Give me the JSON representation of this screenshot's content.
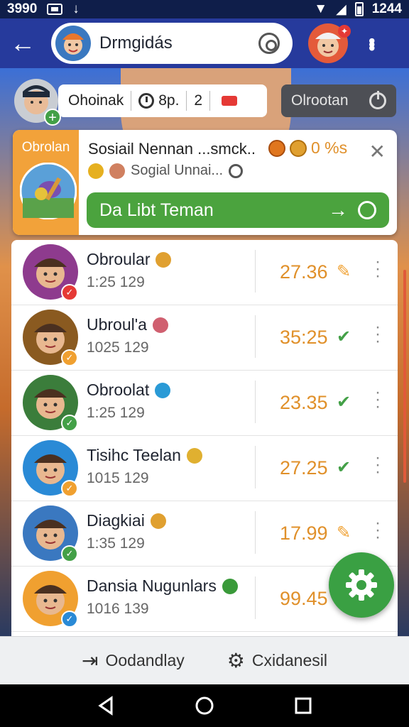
{
  "status_bar": {
    "left_text": "3990",
    "time": "1244"
  },
  "app_bar": {
    "title": "Drmgidás"
  },
  "status_row": {
    "name": "Ohoinak",
    "timer": "8p.",
    "count": "2",
    "action_label": "Olrootan"
  },
  "featured": {
    "tag": "Obrolan",
    "name": "Sosiail Nennan ...smck..",
    "percent": "0 %s",
    "subtitle": "Sogial Unnai...",
    "cta_label": "Da Libt Teman"
  },
  "items": [
    {
      "name": "Obroular",
      "time": "1:25 129",
      "value": "27.36",
      "status": "pending",
      "badge_color": "#e53935",
      "avatar_color": "#8e3b8e",
      "emoji_color": "#e0a030"
    },
    {
      "name": "Ubroul'a",
      "time": "1025 129",
      "value": "35:25",
      "status": "done",
      "badge_color": "#f0a030",
      "avatar_color": "#8a5a20",
      "emoji_color": "#d06070"
    },
    {
      "name": "Obroolat",
      "time": "1:25 129",
      "value": "23.35",
      "status": "done",
      "badge_color": "#43a047",
      "avatar_color": "#3b7d3b",
      "emoji_color": "#2a9ad6"
    },
    {
      "name": "Tisihc Teelan",
      "time": "1015 129",
      "value": "27.25",
      "status": "done",
      "badge_color": "#f0a030",
      "avatar_color": "#2a8ad6",
      "emoji_color": "#e0b030"
    },
    {
      "name": "Diagkiai",
      "time": "1:35 129",
      "value": "17.99",
      "status": "pending",
      "badge_color": "#43a047",
      "avatar_color": "#3a78c0",
      "emoji_color": "#e0a030"
    },
    {
      "name": "Dansia Nugunlars",
      "time": "1016 139",
      "value": "99.45",
      "status": "done",
      "badge_color": "#2a8ad6",
      "avatar_color": "#f0a030",
      "emoji_color": "#3a9a3a"
    }
  ],
  "bottom_bar": {
    "left_label": "Oodandlay",
    "right_label": "Cxidanesil"
  },
  "icons": {
    "back": "back-arrow-icon",
    "search": "search-icon",
    "more": "more-vert-icon",
    "settings": "gear-icon",
    "check": "check-icon",
    "pending": "bell-icon"
  },
  "colors": {
    "app_bar": "#263a9c",
    "accent_green": "#4ba33e",
    "accent_orange": "#f2a23a",
    "value_text": "#e0902a"
  }
}
